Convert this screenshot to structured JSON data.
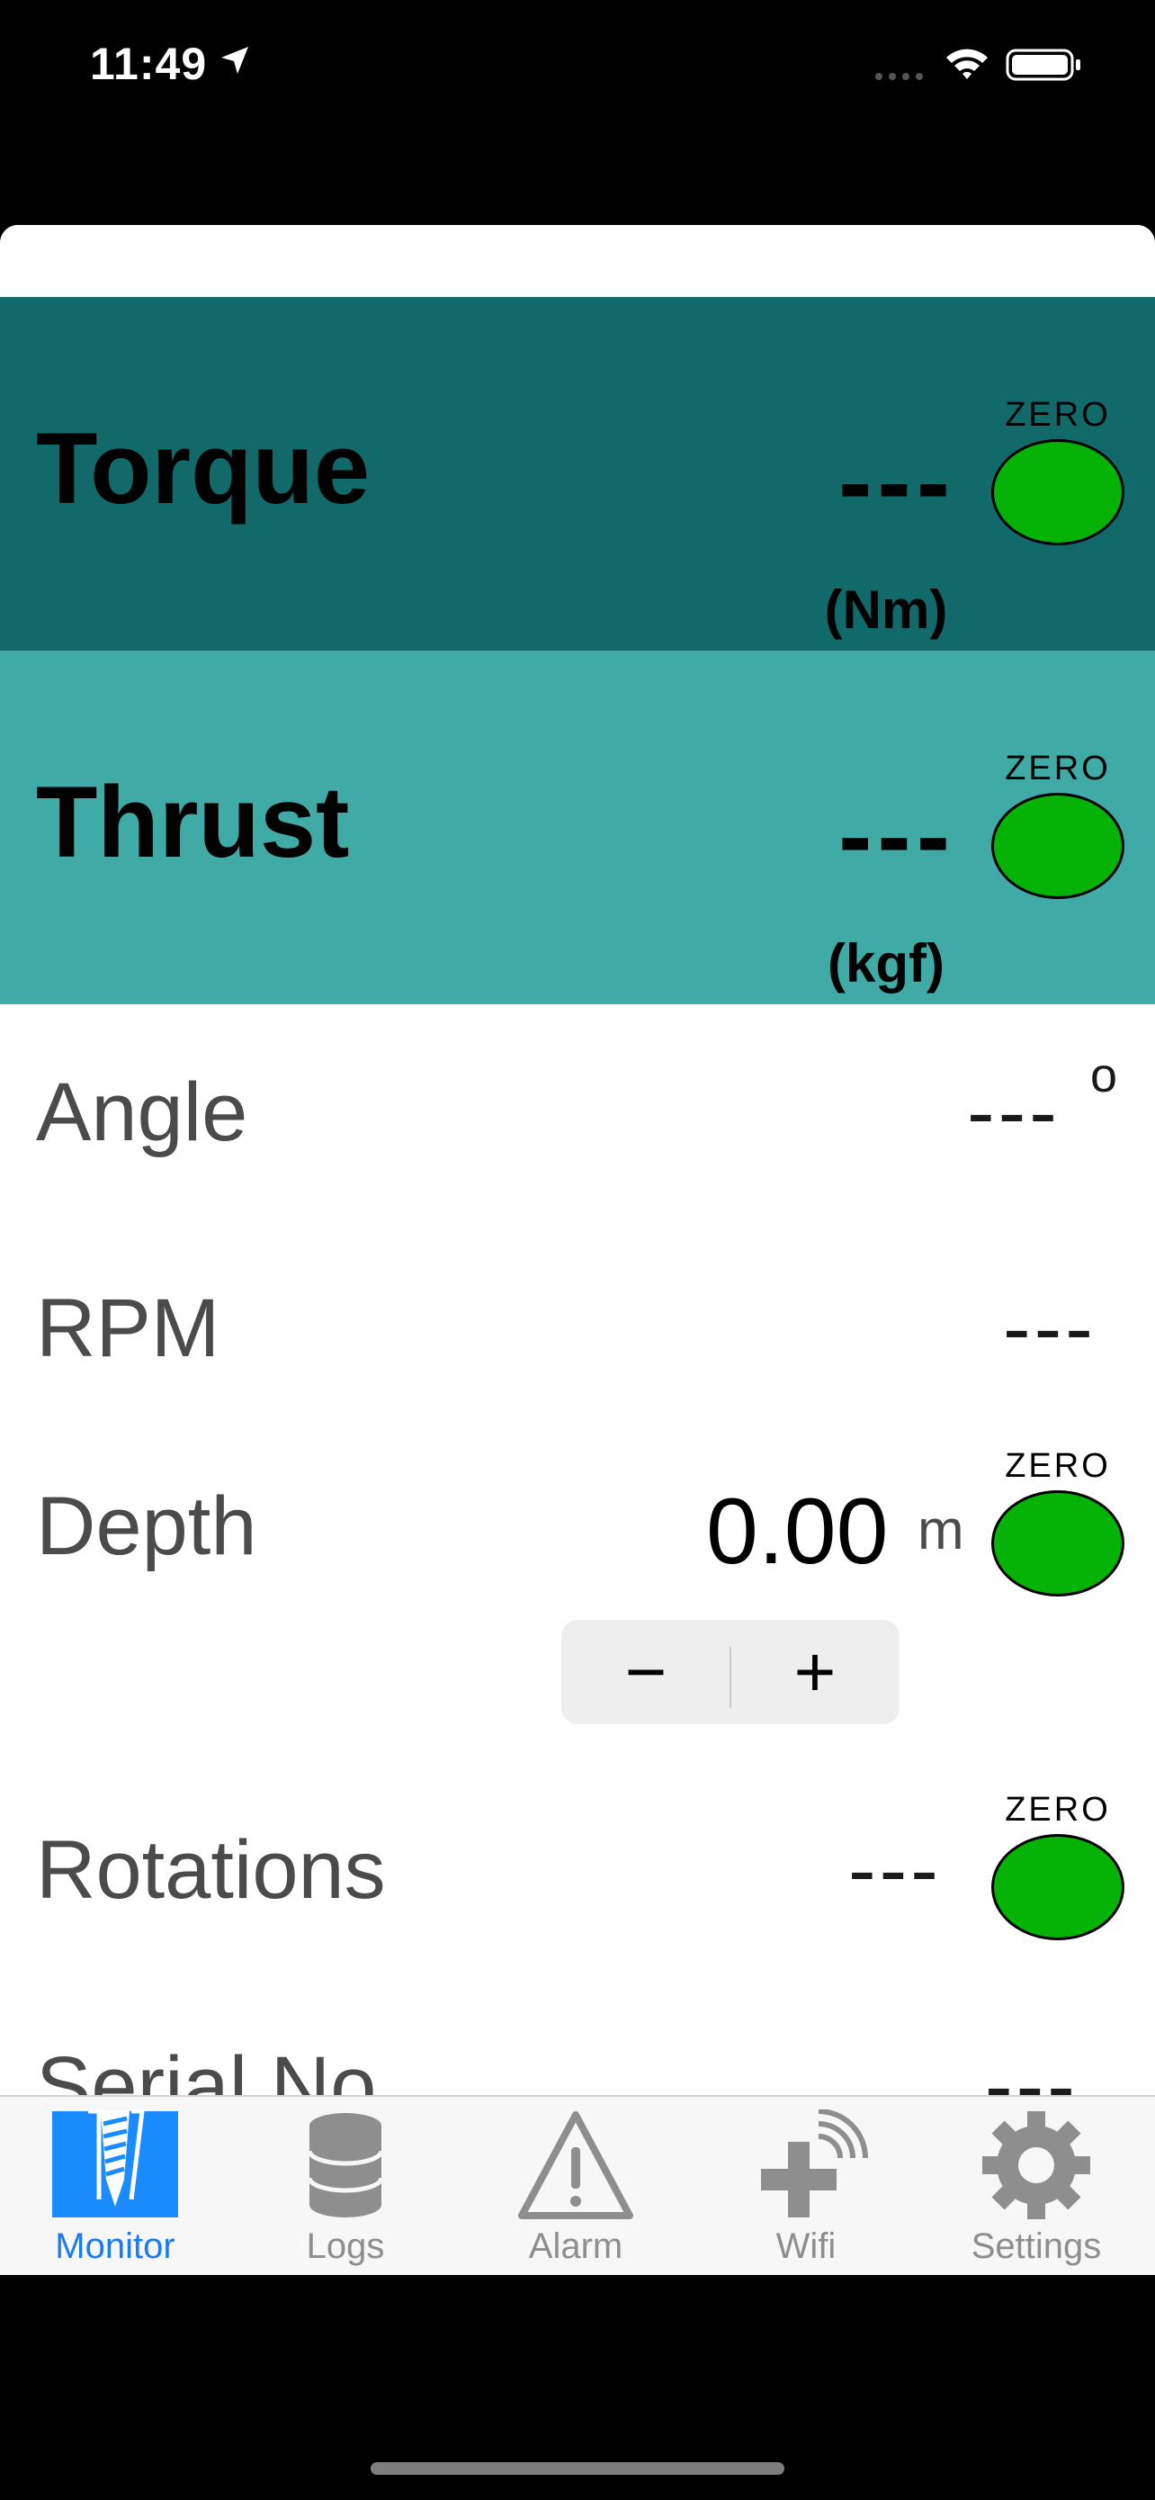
{
  "status_bar": {
    "time": "11:49"
  },
  "torque": {
    "label": "Torque",
    "value": "---",
    "unit": "(Nm)",
    "zero_label": "ZERO"
  },
  "thrust": {
    "label": "Thrust",
    "value": "---",
    "unit": "(kgf)",
    "zero_label": "ZERO"
  },
  "angle": {
    "label": "Angle",
    "value": "---",
    "unit": "o"
  },
  "rpm": {
    "label": "RPM",
    "value": "---"
  },
  "depth": {
    "label": "Depth",
    "value": "0.00",
    "unit": "m",
    "zero_label": "ZERO",
    "stepper_minus": "−",
    "stepper_plus": "+"
  },
  "rotations": {
    "label": "Rotations",
    "value": "---",
    "zero_label": "ZERO"
  },
  "serial": {
    "label": "Serial No",
    "value": "---"
  },
  "tabs": [
    {
      "label": "Monitor",
      "icon": "drill-icon",
      "active": true
    },
    {
      "label": "Logs",
      "icon": "database-icon",
      "active": false
    },
    {
      "label": "Alarm",
      "icon": "warning-icon",
      "active": false
    },
    {
      "label": "Wifi",
      "icon": "wifi-plus-icon",
      "active": false
    },
    {
      "label": "Settings",
      "icon": "gear-icon",
      "active": false
    }
  ],
  "colors": {
    "torque_bg": "#12696a",
    "thrust_bg": "#40aaa7",
    "zero_green": "#05b307",
    "active_tab": "#1a7cf0",
    "inactive_tab": "#8e8e8e"
  }
}
